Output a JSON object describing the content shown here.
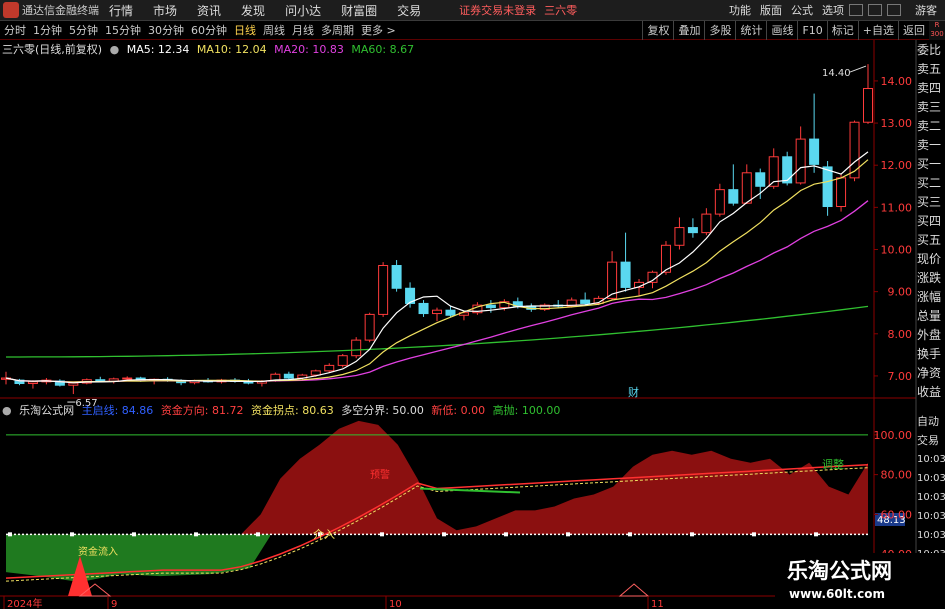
{
  "menubar": {
    "app_name": "通达信金融终端",
    "menus": [
      "行情",
      "市场",
      "资讯",
      "发现",
      "问小达",
      "财富圈",
      "交易"
    ],
    "notice": "证券交易未登录",
    "stock": "三六零",
    "right_menus": [
      "功能",
      "版面",
      "公式",
      "选项"
    ],
    "user": "游客"
  },
  "periods": [
    {
      "label": "分时",
      "active": false
    },
    {
      "label": "1分钟",
      "active": false
    },
    {
      "label": "5分钟",
      "active": false
    },
    {
      "label": "15分钟",
      "active": false
    },
    {
      "label": "30分钟",
      "active": false
    },
    {
      "label": "60分钟",
      "active": false
    },
    {
      "label": "日线",
      "active": true
    },
    {
      "label": "周线",
      "active": false
    },
    {
      "label": "月线",
      "active": false
    },
    {
      "label": "多周期",
      "active": false
    },
    {
      "label": "更多 >",
      "active": false
    }
  ],
  "toolbar": [
    "复权",
    "叠加",
    "多股",
    "统计",
    "画线",
    "F10",
    "标记",
    "+自选",
    "返回"
  ],
  "main_title": {
    "name": "三六零(日线,前复权)",
    "ma5": "MA5: 12.34",
    "ma10": "MA10: 12.04",
    "ma20": "MA20: 10.83",
    "ma60": "MA60: 8.67"
  },
  "right_nav": [
    "委比",
    "卖五",
    "卖四",
    "卖三",
    "卖二",
    "卖一",
    "买一",
    "买二",
    "买三",
    "买四",
    "买五",
    "现价",
    "涨跌",
    "涨幅",
    "总量",
    "外盘",
    "换手",
    "净资",
    "收益"
  ],
  "right_nav2": [
    "自动",
    "交易"
  ],
  "time_list": [
    "10:03",
    "10:03",
    "10:03",
    "10:03",
    "10:03",
    "10:03",
    "10:03",
    "10:03",
    "10:03"
  ],
  "sub_title": {
    "name": "乐淘公式网",
    "main_line": "主启线: 84.86",
    "fund_dir": "资金方向: 81.72",
    "fund_turn": "资金拐点: 80.63",
    "bull_bear": "多空分界: 50.00",
    "low": "新低: 0.00",
    "high": "高抛: 100.00"
  },
  "badge": {
    "line1": "R",
    "line2": "300"
  },
  "annotations": {
    "high_price": "14.40",
    "low_price": "6.57",
    "cai": "财",
    "fund_inflow": "资金流入",
    "jieru": "介入",
    "yuxian": "预警",
    "tiaozheng": "调整",
    "current": "48.13"
  },
  "watermark": {
    "title": "乐淘公式网",
    "url": "www.60lt.com"
  },
  "colors": {
    "up": "#ff3b3b",
    "down": "#5ad8f0",
    "ma5": "#ffffff",
    "ma10": "#f0e060",
    "ma20": "#e040e0",
    "ma60": "#30c030",
    "grid": "#8b0000",
    "fund_area": "#8b1010",
    "green_area": "#1f7a1f"
  },
  "chart_data": [
    {
      "type": "candlestick",
      "title": "三六零(日线,前复权)",
      "y_ticks": [
        7.0,
        8.0,
        9.0,
        10.0,
        11.0,
        12.0,
        13.0,
        14.0
      ],
      "ylim": [
        6.5,
        14.9
      ],
      "x_ticks": [
        "2024年",
        "9",
        "10",
        "11"
      ],
      "candles": [
        [
          6.92,
          7.1,
          6.8,
          6.95
        ],
        [
          6.9,
          6.93,
          6.78,
          6.82
        ],
        [
          6.82,
          6.9,
          6.7,
          6.86
        ],
        [
          6.86,
          6.95,
          6.8,
          6.9
        ],
        [
          6.88,
          6.92,
          6.75,
          6.78
        ],
        [
          6.78,
          6.85,
          6.57,
          6.83
        ],
        [
          6.83,
          6.94,
          6.8,
          6.91
        ],
        [
          6.91,
          6.98,
          6.85,
          6.87
        ],
        [
          6.87,
          6.96,
          6.82,
          6.93
        ],
        [
          6.93,
          6.99,
          6.88,
          6.95
        ],
        [
          6.95,
          6.98,
          6.86,
          6.89
        ],
        [
          6.89,
          6.94,
          6.8,
          6.92
        ],
        [
          6.92,
          6.97,
          6.86,
          6.88
        ],
        [
          6.88,
          6.92,
          6.78,
          6.84
        ],
        [
          6.84,
          6.91,
          6.8,
          6.89
        ],
        [
          6.89,
          6.95,
          6.84,
          6.86
        ],
        [
          6.86,
          6.93,
          6.82,
          6.9
        ],
        [
          6.9,
          6.95,
          6.84,
          6.87
        ],
        [
          6.87,
          6.93,
          6.8,
          6.83
        ],
        [
          6.83,
          6.9,
          6.75,
          6.88
        ],
        [
          6.88,
          7.08,
          6.86,
          7.04
        ],
        [
          7.04,
          7.1,
          6.92,
          6.95
        ],
        [
          6.95,
          7.05,
          6.9,
          7.02
        ],
        [
          7.02,
          7.15,
          6.98,
          7.12
        ],
        [
          7.12,
          7.3,
          7.08,
          7.25
        ],
        [
          7.25,
          7.52,
          7.2,
          7.48
        ],
        [
          7.48,
          7.92,
          7.42,
          7.85
        ],
        [
          7.85,
          8.5,
          7.8,
          8.46
        ],
        [
          8.46,
          9.7,
          8.4,
          9.62
        ],
        [
          9.62,
          9.75,
          9.0,
          9.08
        ],
        [
          9.08,
          9.22,
          8.62,
          8.72
        ],
        [
          8.72,
          8.8,
          8.4,
          8.48
        ],
        [
          8.48,
          8.62,
          8.3,
          8.56
        ],
        [
          8.56,
          8.66,
          8.4,
          8.44
        ],
        [
          8.44,
          8.55,
          8.32,
          8.5
        ],
        [
          8.5,
          8.75,
          8.45,
          8.68
        ],
        [
          8.68,
          8.8,
          8.5,
          8.62
        ],
        [
          8.62,
          8.82,
          8.55,
          8.76
        ],
        [
          8.76,
          8.86,
          8.6,
          8.66
        ],
        [
          8.66,
          8.72,
          8.52,
          8.58
        ],
        [
          8.58,
          8.72,
          8.54,
          8.68
        ],
        [
          8.68,
          8.8,
          8.6,
          8.66
        ],
        [
          8.66,
          8.86,
          8.62,
          8.8
        ],
        [
          8.8,
          8.98,
          8.66,
          8.72
        ],
        [
          8.72,
          8.9,
          8.68,
          8.84
        ],
        [
          8.84,
          9.96,
          8.8,
          9.7
        ],
        [
          9.7,
          10.4,
          9.0,
          9.1
        ],
        [
          9.1,
          9.3,
          8.9,
          9.22
        ],
        [
          9.22,
          9.5,
          9.08,
          9.46
        ],
        [
          9.46,
          10.2,
          9.4,
          10.1
        ],
        [
          10.1,
          10.76,
          10.0,
          10.52
        ],
        [
          10.52,
          10.74,
          10.28,
          10.4
        ],
        [
          10.4,
          10.98,
          10.34,
          10.84
        ],
        [
          10.84,
          11.56,
          10.78,
          11.42
        ],
        [
          11.42,
          12.02,
          11.04,
          11.1
        ],
        [
          11.1,
          12.02,
          11.08,
          11.82
        ],
        [
          11.82,
          11.92,
          11.2,
          11.5
        ],
        [
          11.5,
          12.4,
          11.44,
          12.2
        ],
        [
          12.2,
          12.32,
          11.52,
          11.58
        ],
        [
          11.58,
          12.92,
          11.54,
          12.62
        ],
        [
          12.62,
          13.7,
          11.82,
          12.02
        ],
        [
          11.96,
          12.1,
          10.8,
          11.02
        ],
        [
          11.02,
          11.78,
          10.9,
          11.7
        ],
        [
          11.7,
          13.06,
          11.62,
          13.02
        ],
        [
          13.02,
          14.4,
          12.98,
          13.82
        ]
      ]
    },
    {
      "type": "area",
      "title": "乐淘公式网",
      "y_ticks": [
        40.0,
        60.0,
        80.0,
        100.0
      ],
      "ylim": [
        19,
        118
      ],
      "values": [
        30,
        30,
        30,
        30,
        30,
        30,
        30,
        30,
        30,
        31,
        34,
        40,
        48,
        60,
        78,
        88,
        95,
        103,
        107,
        105,
        95,
        78,
        58,
        52,
        54,
        58,
        62,
        62,
        64,
        68,
        70,
        74,
        84,
        90,
        92,
        90,
        92,
        88,
        86,
        88,
        80,
        86,
        74,
        70,
        86
      ]
    }
  ]
}
